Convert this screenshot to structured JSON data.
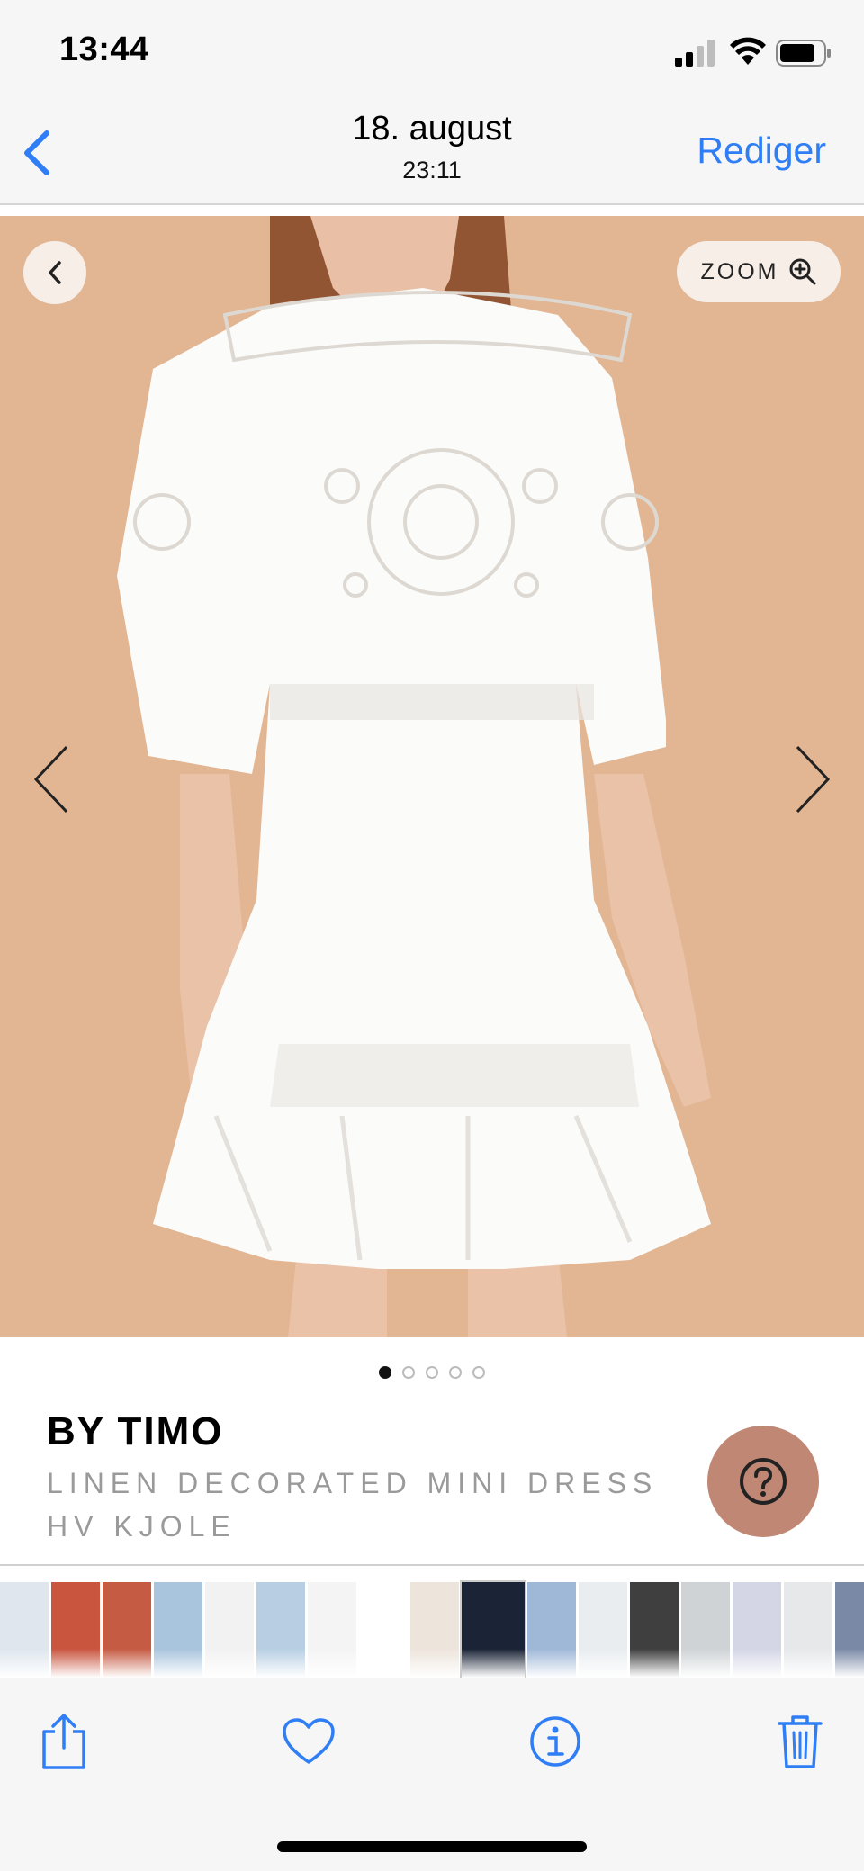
{
  "status": {
    "time": "13:44",
    "signal_icon": "cellular-signal-icon",
    "wifi_icon": "wifi-icon",
    "battery_icon": "battery-icon"
  },
  "nav": {
    "back_icon": "chevron-left-icon",
    "title": "18. august",
    "subtitle": "23:11",
    "edit_label": "Rediger",
    "accent_color": "#2f7ef5"
  },
  "photo": {
    "image_desc_icon": "product-photo",
    "back_icon": "chevron-left-icon",
    "zoom_label": "ZOOM",
    "zoom_icon": "zoom-in-icon",
    "prev_icon": "chevron-left-icon",
    "next_icon": "chevron-right-icon",
    "background_color": "#e2b593",
    "page_count": 5,
    "active_page": 1
  },
  "product": {
    "brand": "BY TIMO",
    "name": "LINEN DECORATED MINI DRESS HV KJOLE",
    "help_icon": "question-mark-icon",
    "help_color": "#c08775"
  },
  "thumbnails": {
    "count": 18
  },
  "toolbar": {
    "share_icon": "share-icon",
    "favorite_icon": "heart-icon",
    "info_icon": "info-icon",
    "delete_icon": "trash-icon"
  }
}
